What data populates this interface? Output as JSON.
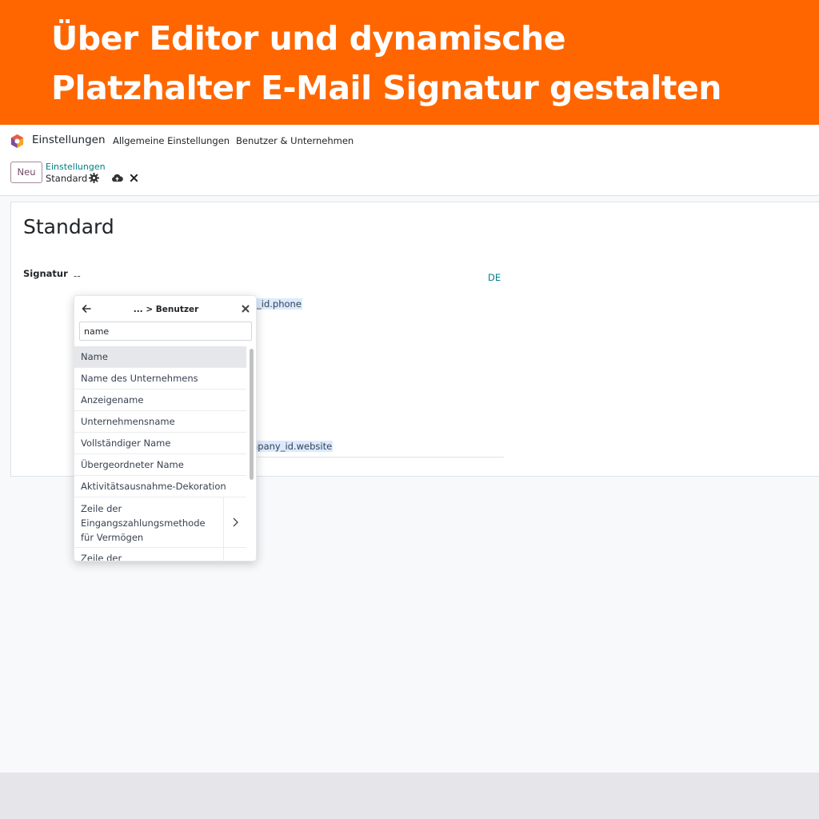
{
  "banner": {
    "line1": "Über Editor und dynamische",
    "line2": "Platzhalter E-Mail Signatur gestalten",
    "color": "#ff6600"
  },
  "topnav": {
    "app_icon": "app-logo-icon",
    "app_name": "Einstellungen",
    "menu": [
      "Allgemeine Einstellungen",
      "Benutzer & Unternehmen"
    ]
  },
  "controlbar": {
    "new_label": "Neu",
    "breadcrumb_parent": "Einstellungen",
    "breadcrumb_current": "Standard",
    "icons": [
      "gear-icon",
      "cloud-upload-icon",
      "close-icon"
    ]
  },
  "record": {
    "title": "Standard",
    "field_label": "Signatur",
    "signature_dashes": "--",
    "lang": "DE",
    "placeholder_fragment_1": "_id.phone",
    "placeholder_fragment_2": "npany_id.website"
  },
  "popover": {
    "title": "... > Benutzer",
    "search_value": "name",
    "items": [
      {
        "label": "Name",
        "selected": true
      },
      {
        "label": "Name des Unternehmens"
      },
      {
        "label": "Anzeigename"
      },
      {
        "label": "Unternehmensname"
      },
      {
        "label": "Vollständiger Name"
      },
      {
        "label": "Übergeordneter Name"
      },
      {
        "label": "Aktivitätsausnahme-Dekoration"
      },
      {
        "label": "Zeile der Eingangszahlungsmethode für Vermögen",
        "has_children": true
      },
      {
        "label": "Zeile der",
        "has_children": true
      }
    ]
  },
  "colors": {
    "accent": "#714b67",
    "link": "#017e84",
    "highlight": "#dbeafe"
  }
}
